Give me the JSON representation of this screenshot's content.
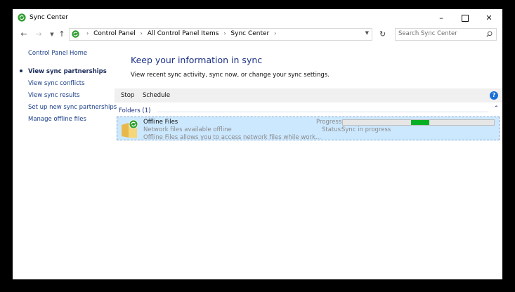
{
  "window": {
    "title": "Sync Center",
    "controls": {
      "minimize": "–",
      "maximize": "",
      "close": "✕"
    }
  },
  "address": {
    "breadcrumbs": [
      "Control Panel",
      "All Control Panel Items",
      "Sync Center"
    ],
    "search_placeholder": "Search Sync Center"
  },
  "sidebar": {
    "items": [
      {
        "label": "Control Panel Home",
        "current": false
      },
      {
        "label": "View sync partnerships",
        "current": true
      },
      {
        "label": "View sync conflicts",
        "current": false
      },
      {
        "label": "View sync results",
        "current": false
      },
      {
        "label": "Set up new sync partnerships",
        "current": false
      },
      {
        "label": "Manage offline files",
        "current": false
      }
    ]
  },
  "main": {
    "heading": "Keep your information in sync",
    "subheading": "View recent sync activity, sync now, or change your sync settings.",
    "toolbar": {
      "stop_label": "Stop",
      "schedule_label": "Schedule",
      "help_label": "?"
    },
    "group": {
      "label": "Folders (1)",
      "collapse_glyph": "⌃"
    },
    "item": {
      "name": "Offline Files",
      "desc1": "Network files available offline",
      "desc2": "Offline Files allows you to access network files while work...",
      "progress_label": "Progress:",
      "status_label": "Status:",
      "status_value": "Sync in progress",
      "progress_fill_start": 0.45,
      "progress_fill_end": 0.57
    }
  },
  "colors": {
    "accent": "#1e3287",
    "link": "#1a3e87",
    "selection": "#cce8ff",
    "progress": "#06b025",
    "help": "#1a6fd6"
  }
}
